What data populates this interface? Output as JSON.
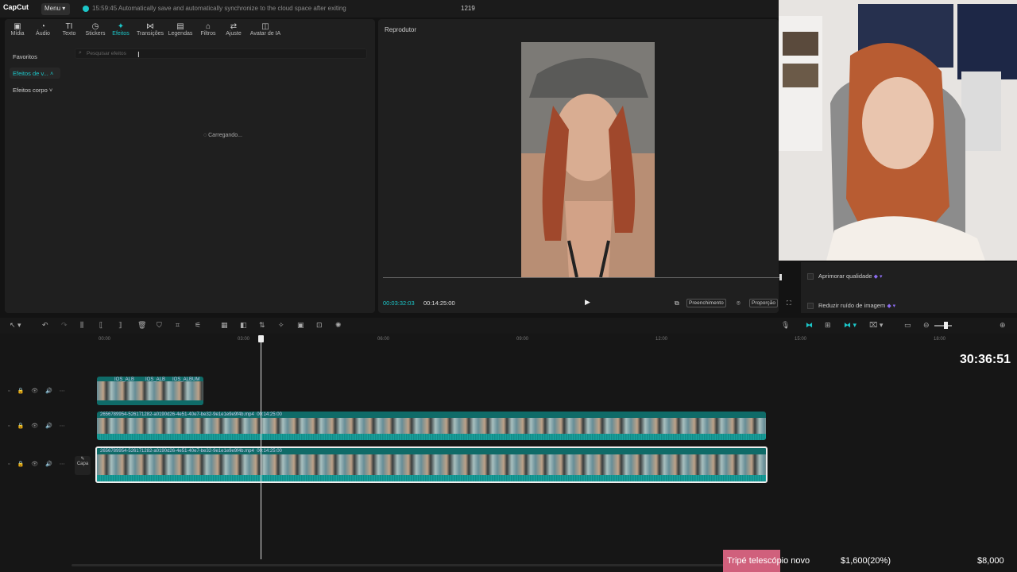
{
  "app": {
    "logo": "CapCut",
    "menu_label": "Menu ▾",
    "autosave_text": "15:59:45 Automatically save and automatically synchronize to the cloud space after exiting",
    "project_number": "1219"
  },
  "toolbar": {
    "tabs": [
      {
        "label": "Mídia",
        "icon": "media-icon"
      },
      {
        "label": "Áudio",
        "icon": "audio-icon"
      },
      {
        "label": "Texto",
        "icon": "text-icon"
      },
      {
        "label": "Stickers",
        "icon": "sticker-icon"
      },
      {
        "label": "Efeitos",
        "icon": "effects-icon",
        "active": true
      },
      {
        "label": "Transições",
        "icon": "transition-icon"
      },
      {
        "label": "Legendas",
        "icon": "captions-icon"
      },
      {
        "label": "Filtros",
        "icon": "filter-icon"
      },
      {
        "label": "Ajuste",
        "icon": "adjust-icon"
      },
      {
        "label": "Avatar de IA",
        "icon": "avatar-icon"
      }
    ]
  },
  "effects_panel": {
    "categories": [
      "Favoritos",
      "Efeitos de v...",
      "Efeitos corpo"
    ],
    "search_placeholder": "Pesquisar efeitos",
    "loading_text": "Carregando..."
  },
  "player": {
    "title": "Reprodutor",
    "current_time": "00:03:32:03",
    "total_time": "00:14:25:00",
    "fill_label": "Preenchimento",
    "ratio_label": "Proporção"
  },
  "properties": {
    "enhance_quality": "Aprimorar qualidade",
    "reduce_noise": "Reduzir ruído de imagem"
  },
  "timeline": {
    "ruler": [
      "00:00",
      "03:00",
      "06:00",
      "09:00",
      "12:00",
      "15:00",
      "18:00"
    ],
    "overlay_clips": [
      "IOS_ALB",
      "IOS_ALB",
      "IOS_ALBUM"
    ],
    "main_clip_label": "2656789954-526171282-a0190d26-4e51-40e7-be32-9e1e1e9e9f4b.mp4",
    "main_clip_duration": "00:14:25:00",
    "cover_label": "Capa"
  },
  "overlay": {
    "stream_timer": "30:36:51",
    "ticker_item": "Tripé telescópio novo",
    "ticker_progress": "$1,600(20%)",
    "ticker_goal": "$8,000"
  },
  "colors": {
    "accent": "#1cc6c8",
    "clip": "#0f6b68",
    "ticker": "#d0607c"
  }
}
